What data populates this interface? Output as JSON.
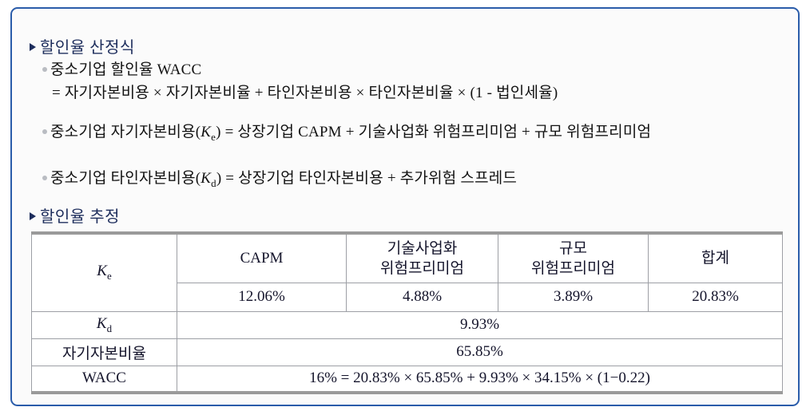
{
  "slide": {
    "border_color": "#2a5caa",
    "background": "#fbfbfb",
    "heading_color": "#1d2d5c"
  },
  "section1": {
    "heading": "할인율 산정식",
    "items": [
      {
        "text": "중소기업 할인율 WACC"
      },
      {
        "text": "= 자기자본비용 × 자기자본비율 + 타인자본비용 × 타인자본비율 × (1 - 법인세율)"
      },
      {
        "prefix": "중소기업 자기자본비용(",
        "var": "K",
        "sub": "e",
        "suffix": ") = 상장기업 CAPM + 기술사업화 위험프리미엄 + 규모 위험프리미엄"
      },
      {
        "prefix": "중소기업 타인자본비용(",
        "var": "K",
        "sub": "d",
        "suffix": ") = 상장기업 타인자본비용 + 추가위험 스프레드"
      }
    ]
  },
  "section2": {
    "heading": "할인율 추정",
    "table": {
      "headers": [
        "CAPM",
        "기술사업화\n위험프리미엄",
        "규모\n위험프리미엄",
        "합계"
      ],
      "header_capm": "CAPM",
      "header_tech_line1": "기술사업화",
      "header_tech_line2": "위험프리미엄",
      "header_scale_line1": "규모",
      "header_scale_line2": "위험프리미엄",
      "header_total": "합계",
      "ke_label_var": "K",
      "ke_label_sub": "e",
      "ke_values": [
        "12.06%",
        "4.88%",
        "3.89%",
        "20.83%"
      ],
      "ke_capm": "12.06%",
      "ke_tech": "4.88%",
      "ke_scale": "3.89%",
      "ke_total": "20.83%",
      "kd_label_var": "K",
      "kd_label_sub": "d",
      "kd_value": "9.93%",
      "equity_ratio_label": "자기자본비율",
      "equity_ratio_value": "65.85%",
      "wacc_label": "WACC",
      "wacc_value": "16% = 20.83% × 65.85% + 9.93% × 34.15% × (1−0.22)"
    }
  }
}
